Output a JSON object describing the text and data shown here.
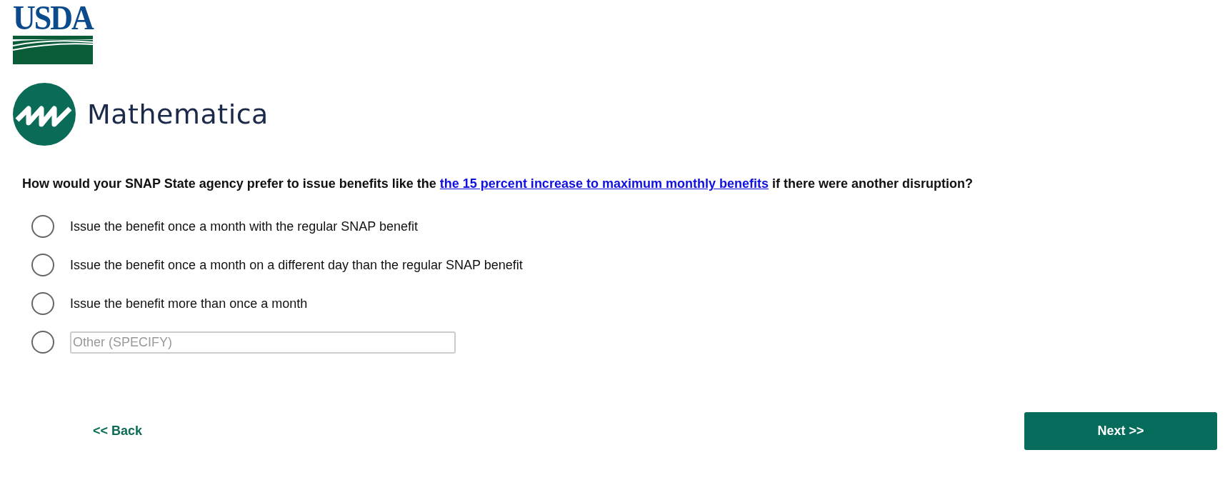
{
  "logos": [
    {
      "kind": "usda",
      "text": "USDA"
    },
    {
      "kind": "mathematica",
      "text": "Mathematica"
    }
  ],
  "question": {
    "before": "How would your SNAP State agency prefer to issue benefits like the",
    "link": "the 15 percent increase to maximum monthly benefits",
    "after": "if there were another disruption?"
  },
  "options": [
    {
      "kind": "text",
      "label": "Issue the benefit once a month with the regular SNAP benefit",
      "selected": false
    },
    {
      "kind": "text",
      "label": "Issue the benefit once a month on a different day than the regular SNAP benefit",
      "selected": false
    },
    {
      "kind": "text",
      "label": "Issue the benefit more than once a month",
      "selected": false
    },
    {
      "kind": "other",
      "placeholder": "Other (SPECIFY)",
      "selected": false
    }
  ],
  "nav": {
    "back": "<< Back",
    "next": "Next >>"
  }
}
